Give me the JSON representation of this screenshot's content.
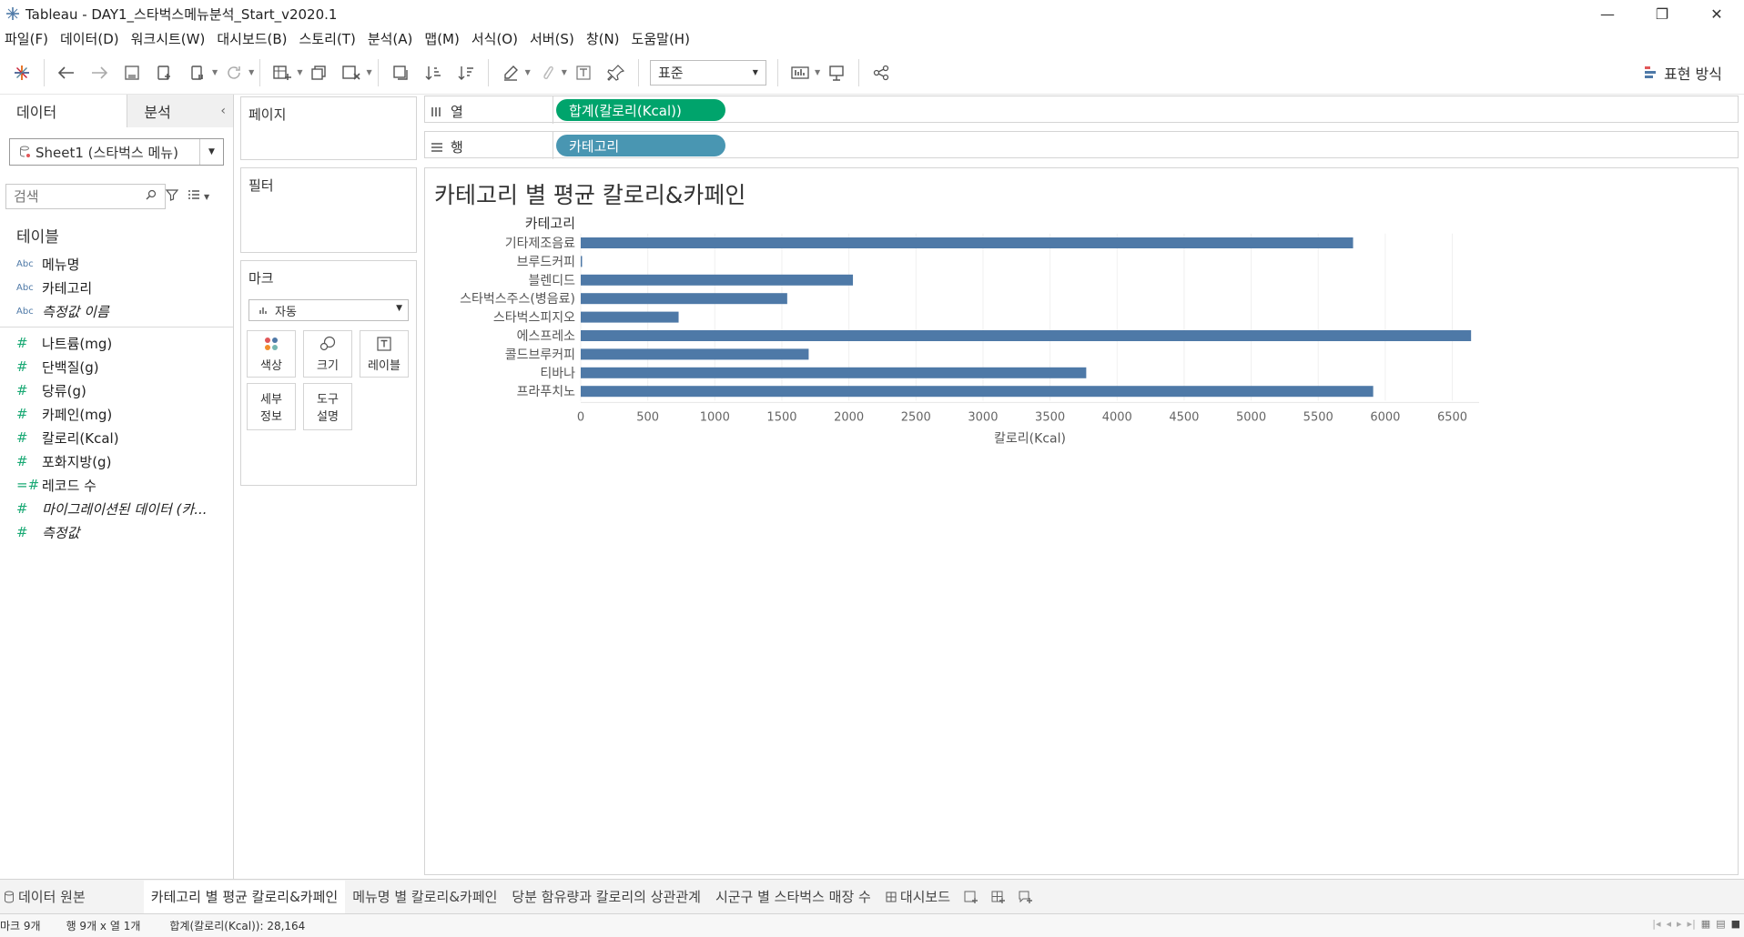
{
  "window": {
    "title": "Tableau - DAY1_스타벅스메뉴분석_Start_v2020.1",
    "minimize": "—",
    "restore": "❐",
    "close": "✕"
  },
  "menu": [
    "파일(F)",
    "데이터(D)",
    "워크시트(W)",
    "대시보드(B)",
    "스토리(T)",
    "분석(A)",
    "맵(M)",
    "서식(O)",
    "서버(S)",
    "창(N)",
    "도움말(H)"
  ],
  "toolbar": {
    "fit_value": "표준",
    "show_me_label": "표현 방식"
  },
  "data_pane": {
    "tab_data": "데이터",
    "tab_analysis": "분석",
    "datasource": "Sheet1 (스타벅스 메뉴)",
    "search_placeholder": "검색",
    "tables_heading": "테이블",
    "dimensions": [
      {
        "type": "Abc",
        "name": "메뉴명",
        "italic": false
      },
      {
        "type": "Abc",
        "name": "카테고리",
        "italic": false
      },
      {
        "type": "Abc",
        "name": "측정값 이름",
        "italic": true
      }
    ],
    "measures": [
      {
        "type": "#",
        "name": "나트륨(mg)",
        "italic": false
      },
      {
        "type": "#",
        "name": "단백질(g)",
        "italic": false
      },
      {
        "type": "#",
        "name": "당류(g)",
        "italic": false
      },
      {
        "type": "#",
        "name": "카페인(mg)",
        "italic": false
      },
      {
        "type": "#",
        "name": "칼로리(Kcal)",
        "italic": false
      },
      {
        "type": "#",
        "name": "포화지방(g)",
        "italic": false
      },
      {
        "type": "=#",
        "name": "레코드 수",
        "italic": false
      },
      {
        "type": "#",
        "name": "마이그레이션된 데이터 (카...",
        "italic": true
      },
      {
        "type": "#",
        "name": "측정값",
        "italic": true
      }
    ]
  },
  "cards": {
    "pages": "페이지",
    "filters": "필터",
    "marks": "마크",
    "mark_type": "자동",
    "color": "색상",
    "size": "크기",
    "label": "레이블",
    "detail_line1": "세부",
    "detail_line2": "정보",
    "tooltip_line1": "도구",
    "tooltip_line2": "설명"
  },
  "shelves": {
    "columns_label": "열",
    "rows_label": "행",
    "columns_pill": "합계(칼로리(Kcal))",
    "rows_pill": "카테고리"
  },
  "chart_data": {
    "type": "bar",
    "orientation": "horizontal",
    "title": "카테고리 별 평균 칼로리&카페인",
    "category_header": "카테고리",
    "xlabel": "칼로리(Kcal)",
    "categories": [
      "기타제조음료",
      "브루드커피",
      "블렌디드",
      "스타벅스주스(병음료)",
      "스타벅스피지오",
      "에스프레소",
      "콜드브루커피",
      "티바나",
      "프라푸치노"
    ],
    "values": [
      5760,
      10,
      2030,
      1540,
      730,
      6640,
      1700,
      3770,
      5910
    ],
    "xticks": [
      0,
      500,
      1000,
      1500,
      2000,
      2500,
      3000,
      3500,
      4000,
      4500,
      5000,
      5500,
      6000,
      6500
    ],
    "xlim": [
      0,
      6700
    ],
    "bar_color": "#4e79a7",
    "grid": true
  },
  "sheet_tabs": {
    "data_source": "데이터 원본",
    "tabs": [
      "카테고리 별 평균 칼로리&카페인",
      "메뉴명 별 칼로리&카페인",
      "당분 함유량과 칼로리의 상관관계",
      "시군구 별 스타벅스 매장 수",
      "대시보드"
    ],
    "active_index": 0
  },
  "status": {
    "marks": "마크 9개",
    "rows_cols": "행 9개 x 열 1개",
    "sum": "합계(칼로리(Kcal)): 28,164"
  }
}
